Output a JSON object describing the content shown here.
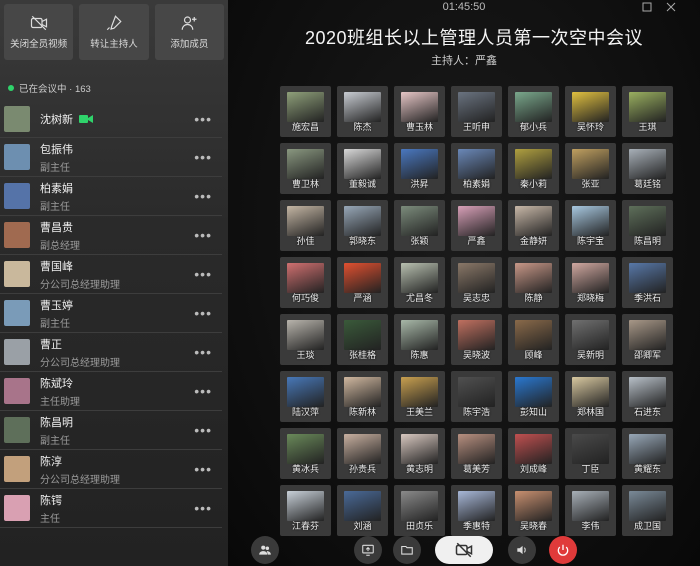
{
  "toolbar": {
    "mute_video": "关闭全员视频",
    "transfer_host": "转让主持人",
    "add_member": "添加成员"
  },
  "status": {
    "label": "已在会议中 · 163"
  },
  "members": [
    {
      "name": "沈树新",
      "role": "",
      "avatar": "#7a8a70",
      "camera": true
    },
    {
      "name": "包振伟",
      "role": "副主任",
      "avatar": "#6d8fb0"
    },
    {
      "name": "柏素娟",
      "role": "副主任",
      "avatar": "#5573a8"
    },
    {
      "name": "曹昌贵",
      "role": "副总经理",
      "avatar": "#a06a50"
    },
    {
      "name": "曹国峰",
      "role": "分公司总经理助理",
      "avatar": "#c9b89c"
    },
    {
      "name": "曹玉婷",
      "role": "副主任",
      "avatar": "#7a9bb8"
    },
    {
      "name": "曹正",
      "role": "分公司总经理助理",
      "avatar": "#9aa0a6"
    },
    {
      "name": "陈斌玲",
      "role": "主任助理",
      "avatar": "#a8748a"
    },
    {
      "name": "陈昌明",
      "role": "副主任",
      "avatar": "#5e6f5a"
    },
    {
      "name": "陈淳",
      "role": "分公司总经理助理",
      "avatar": "#c2a07c"
    },
    {
      "name": "陈锷",
      "role": "主任",
      "avatar": "#d9a0b2"
    }
  ],
  "clock": "01:45:50",
  "meeting": {
    "title": "2020班组长以上管理人员第一次空中会议",
    "host": "主持人：严鑫"
  },
  "participants": [
    {
      "name": "施宏昌",
      "c": "#8fa07a"
    },
    {
      "name": "陈杰",
      "c": "#c8ccd2"
    },
    {
      "name": "曹玉林",
      "c": "#e6c6c6"
    },
    {
      "name": "王听申",
      "c": "#6a7380"
    },
    {
      "name": "郁小兵",
      "c": "#7aa88c"
    },
    {
      "name": "吴怀玲",
      "c": "#e0c040"
    },
    {
      "name": "王琪",
      "c": "#9ab060"
    },
    {
      "name": "曹卫林",
      "c": "#8a9880"
    },
    {
      "name": "董毅诚",
      "c": "#d8d8d8"
    },
    {
      "name": "洪昇",
      "c": "#4a78c0"
    },
    {
      "name": "柏素娟",
      "c": "#6a88b8"
    },
    {
      "name": "秦小莉",
      "c": "#b0a040"
    },
    {
      "name": "张亚",
      "c": "#c0a060"
    },
    {
      "name": "葛廷铭",
      "c": "#a8b0b8"
    },
    {
      "name": "孙佳",
      "c": "#c4b6a4"
    },
    {
      "name": "郭晓东",
      "c": "#98a8b8"
    },
    {
      "name": "张颖",
      "c": "#7c8c7c"
    },
    {
      "name": "严鑫",
      "c": "#d8a0b8"
    },
    {
      "name": "金静妍",
      "c": "#c8b8a8"
    },
    {
      "name": "陈宇宝",
      "c": "#a8c8e0"
    },
    {
      "name": "陈昌明",
      "c": "#5e6f5a"
    },
    {
      "name": "何巧俊",
      "c": "#d07070"
    },
    {
      "name": "严涵",
      "c": "#e05030"
    },
    {
      "name": "尤昌冬",
      "c": "#b8c0b0"
    },
    {
      "name": "吴志忠",
      "c": "#8a7868"
    },
    {
      "name": "陈静",
      "c": "#c89888"
    },
    {
      "name": "郑晓梅",
      "c": "#d0a8a0"
    },
    {
      "name": "季洪石",
      "c": "#5878a8"
    },
    {
      "name": "王琰",
      "c": "#b8b4ac"
    },
    {
      "name": "张桂格",
      "c": "#3a5a3a"
    },
    {
      "name": "陈惠",
      "c": "#a8b8a8"
    },
    {
      "name": "吴晓波",
      "c": "#c07060"
    },
    {
      "name": "顾峰",
      "c": "#8a6a4a"
    },
    {
      "name": "吴新明",
      "c": "#707070"
    },
    {
      "name": "邵卿军",
      "c": "#a89888"
    },
    {
      "name": "陆汉萍",
      "c": "#4878b8"
    },
    {
      "name": "陈新林",
      "c": "#d0b8a0"
    },
    {
      "name": "王美兰",
      "c": "#c8a050"
    },
    {
      "name": "陈宇浩",
      "c": "#505050"
    },
    {
      "name": "彭知山",
      "c": "#2a78d0"
    },
    {
      "name": "郑林国",
      "c": "#d8c8a0"
    },
    {
      "name": "石进东",
      "c": "#b8c0c8"
    },
    {
      "name": "黄冰兵",
      "c": "#6a8a5a"
    },
    {
      "name": "孙贵兵",
      "c": "#c8b0a0"
    },
    {
      "name": "黄志明",
      "c": "#d8c8c0"
    },
    {
      "name": "葛美芳",
      "c": "#b89080"
    },
    {
      "name": "刘成峰",
      "c": "#c05050"
    },
    {
      "name": "丁臣",
      "c": "#4a4a4a"
    },
    {
      "name": "黄耀东",
      "c": "#98a8b8"
    },
    {
      "name": "江春芬",
      "c": "#c8d0d8"
    },
    {
      "name": "刘涵",
      "c": "#4a6a98"
    },
    {
      "name": "田贞乐",
      "c": "#8a8a8a"
    },
    {
      "name": "季惠特",
      "c": "#a8b8d8"
    },
    {
      "name": "吴晓春",
      "c": "#c89070"
    },
    {
      "name": "李伟",
      "c": "#a8b0b8"
    },
    {
      "name": "成卫国",
      "c": "#7a8a98"
    }
  ]
}
